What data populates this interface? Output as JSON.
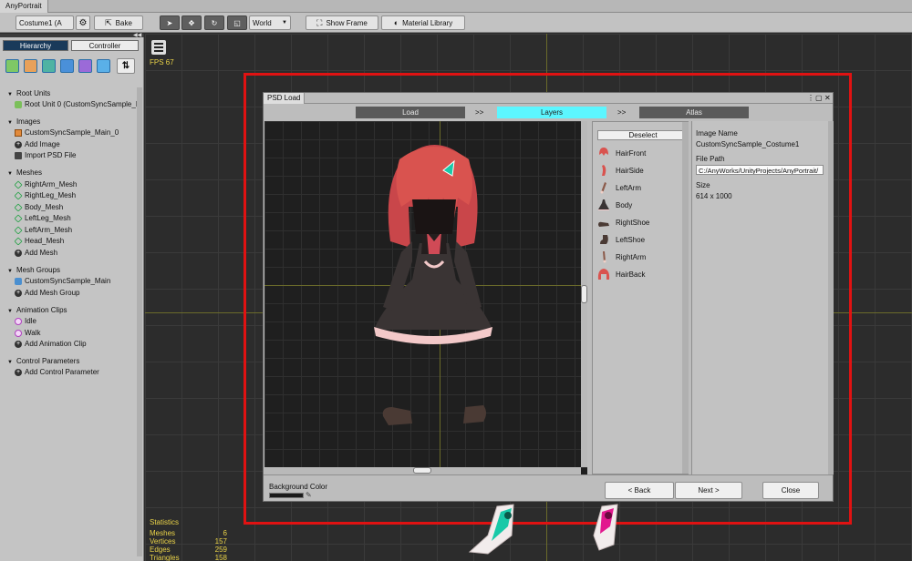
{
  "app": {
    "title": "AnyPortrait"
  },
  "toolbar": {
    "costume_select": "Costume1 (A",
    "bake_label": "Bake",
    "space_select": "World",
    "show_frame_label": "Show Frame",
    "material_library_label": "Material Library"
  },
  "left": {
    "tabs": {
      "hierarchy": "Hierarchy",
      "controller": "Controller"
    },
    "sort_label": "⇅",
    "sections": {
      "root_units": {
        "title": "Root Units",
        "items": [
          "Root Unit 0 (CustomSyncSample_M"
        ]
      },
      "images": {
        "title": "Images",
        "items": [
          "CustomSyncSample_Main_0",
          "Add Image",
          "Import PSD File"
        ]
      },
      "meshes": {
        "title": "Meshes",
        "items": [
          "RightArm_Mesh",
          "RightLeg_Mesh",
          "Body_Mesh",
          "LeftLeg_Mesh",
          "LeftArm_Mesh",
          "Head_Mesh",
          "Add Mesh"
        ]
      },
      "mesh_groups": {
        "title": "Mesh Groups",
        "items": [
          "CustomSyncSample_Main",
          "Add Mesh Group"
        ]
      },
      "animation_clips": {
        "title": "Animation Clips",
        "items": [
          "Idle",
          "Walk",
          "Add Animation Clip"
        ]
      },
      "control_parameters": {
        "title": "Control Parameters",
        "items": [
          "Add Control Parameter"
        ]
      }
    }
  },
  "viewport": {
    "fps": "FPS 67",
    "stats": {
      "title": "Statistics",
      "rows": [
        {
          "label": "Meshes",
          "value": "6"
        },
        {
          "label": "Vertices",
          "value": "157"
        },
        {
          "label": "Edges",
          "value": "259"
        },
        {
          "label": "Triangles",
          "value": "158"
        }
      ]
    }
  },
  "dialog": {
    "title": "PSD Load",
    "steps": {
      "load": "Load",
      "layers": "Layers",
      "atlas": "Atlas",
      "arrow1": ">>",
      "arrow2": ">>"
    },
    "deselect_label": "Deselect",
    "layers": [
      {
        "name": "HairFront",
        "color": "#d9534f"
      },
      {
        "name": "HairSide",
        "color": "#d9534f"
      },
      {
        "name": "LeftArm",
        "color": "#8b5a4a"
      },
      {
        "name": "Body",
        "color": "#3a3a3a"
      },
      {
        "name": "RightShoe",
        "color": "#4a3a34"
      },
      {
        "name": "LeftShoe",
        "color": "#4a3a34"
      },
      {
        "name": "RightArm",
        "color": "#8b5a4a"
      },
      {
        "name": "HairBack",
        "color": "#d9534f"
      }
    ],
    "info": {
      "image_name_label": "Image Name",
      "image_name": "CustomSyncSample_Costume1",
      "file_path_label": "File Path",
      "file_path": "C:/AnyWorks/UnityProjects/AnyPortrait/",
      "size_label": "Size",
      "size": "614 x 1000"
    },
    "background_color_label": "Background Color",
    "back_label": "< Back",
    "next_label": "Next >",
    "close_label": "Close"
  },
  "colors": {
    "highlight": "#e01212",
    "step_active": "#5cf6ff",
    "fps_text": "#ead348",
    "hierarchy_tab": "#193a5a"
  }
}
